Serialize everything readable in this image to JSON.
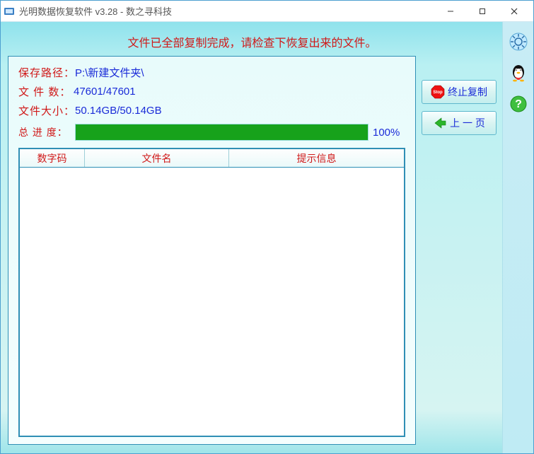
{
  "window": {
    "title": "光明数据恢复软件 v3.28 - 数之寻科技"
  },
  "status_message": "文件已全部复制完成，请检查下恢复出来的文件。",
  "info": {
    "save_path_label": "保存路径：",
    "save_path_value": "P:\\新建文件夹\\",
    "file_count_label": "文 件 数：",
    "file_count_value": "47601/47601",
    "file_size_label": "文件大小：",
    "file_size_value": "50.14GB/50.14GB",
    "progress_label": "总 进 度：",
    "progress_percent": "100%",
    "progress_fill_pct": 100
  },
  "table": {
    "col1": "数字码",
    "col2": "文件名",
    "col3": "提示信息"
  },
  "buttons": {
    "stop_copy": "终止复制",
    "prev_page": "上 一 页"
  },
  "side": {
    "settings": "settings",
    "qq": "qq",
    "help": "help"
  }
}
